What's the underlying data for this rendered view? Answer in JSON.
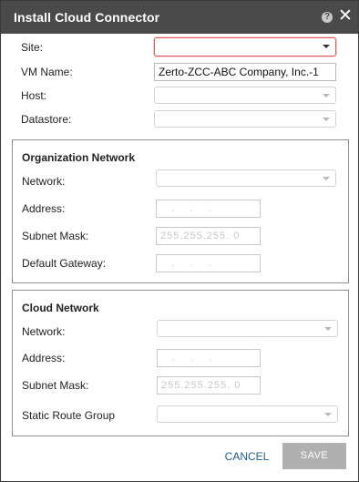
{
  "dialog": {
    "title": "Install Cloud Connector",
    "help_icon": "question-icon",
    "close_icon": "close-icon"
  },
  "fields": {
    "site_label": "Site:",
    "vm_name_label": "VM Name:",
    "vm_name_value": "Zerto-ZCC-ABC Company, Inc.-1",
    "host_label": "Host:",
    "datastore_label": "Datastore:"
  },
  "org_network": {
    "title": "Organization Network",
    "network_label": "Network:",
    "address_label": "Address:",
    "address_value": "   .    .    .",
    "subnet_label": "Subnet Mask:",
    "subnet_value": "255.255.255. 0",
    "gateway_label": "Default Gateway:",
    "gateway_value": "   .    .    ."
  },
  "cloud_network": {
    "title": "Cloud Network",
    "network_label": "Network:",
    "address_label": "Address:",
    "address_value": "   .    .    .",
    "subnet_label": "Subnet Mask:",
    "subnet_value": "255.255.255. 0",
    "route_label": "Static Route Group"
  },
  "footer": {
    "cancel_label": "CANCEL",
    "save_label": "SAVE"
  },
  "colors": {
    "titlebar": "#4a4a4a",
    "accent_link": "#1f5e8e",
    "error_border": "#e05a5a",
    "disabled_button": "#b0b0b0"
  }
}
